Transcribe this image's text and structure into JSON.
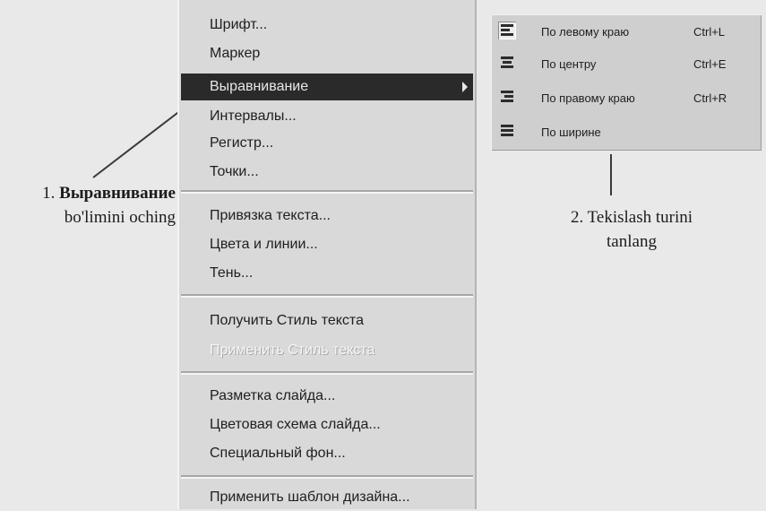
{
  "menu": {
    "groups": [
      {
        "items": [
          {
            "label": "Шрифт...",
            "enabled": true
          },
          {
            "label": "Маркер",
            "enabled": true
          },
          {
            "label": "Выравнивание",
            "enabled": true,
            "highlighted": true,
            "has_submenu": true
          },
          {
            "label": "Интервалы...",
            "enabled": true
          },
          {
            "label": "Регистр...",
            "enabled": true
          },
          {
            "label": "Точки...",
            "enabled": true
          }
        ]
      },
      {
        "items": [
          {
            "label": "Привязка текста...",
            "enabled": true
          },
          {
            "label": "Цвета и линии...",
            "enabled": true
          },
          {
            "label": "Тень...",
            "enabled": true
          }
        ]
      },
      {
        "items": [
          {
            "label": "Получить Стиль текста",
            "enabled": true
          },
          {
            "label": "Применить Стиль текста",
            "enabled": false
          }
        ]
      },
      {
        "items": [
          {
            "label": "Разметка слайда...",
            "enabled": true
          },
          {
            "label": "Цветовая схема слайда...",
            "enabled": true
          },
          {
            "label": "Специальный фон...",
            "enabled": true
          }
        ]
      },
      {
        "items": [
          {
            "label": "Применить шаблон дизайна...",
            "enabled": true
          }
        ]
      }
    ]
  },
  "submenu": {
    "items": [
      {
        "label": "По левому краю",
        "shortcut": "Ctrl+L",
        "icon": "align-left-icon",
        "selected": true
      },
      {
        "label": "По центру",
        "shortcut": "Ctrl+E",
        "icon": "align-center-icon",
        "selected": false
      },
      {
        "label": "По правому краю",
        "shortcut": "Ctrl+R",
        "icon": "align-right-icon",
        "selected": false
      },
      {
        "label": "По ширине",
        "shortcut": "",
        "icon": "align-justify-icon",
        "selected": false
      }
    ]
  },
  "callouts": {
    "step1_prefix": "1. ",
    "step1_bold": "Выравнивание",
    "step1_rest": "bo'limini oching",
    "step2_line1": "2. Tekislash turini",
    "step2_line2": "tanlang"
  },
  "colors": {
    "menu_bg": "#d9d9d9",
    "highlight_bg": "#2a2a2a",
    "page_bg": "#e9e9e9"
  }
}
